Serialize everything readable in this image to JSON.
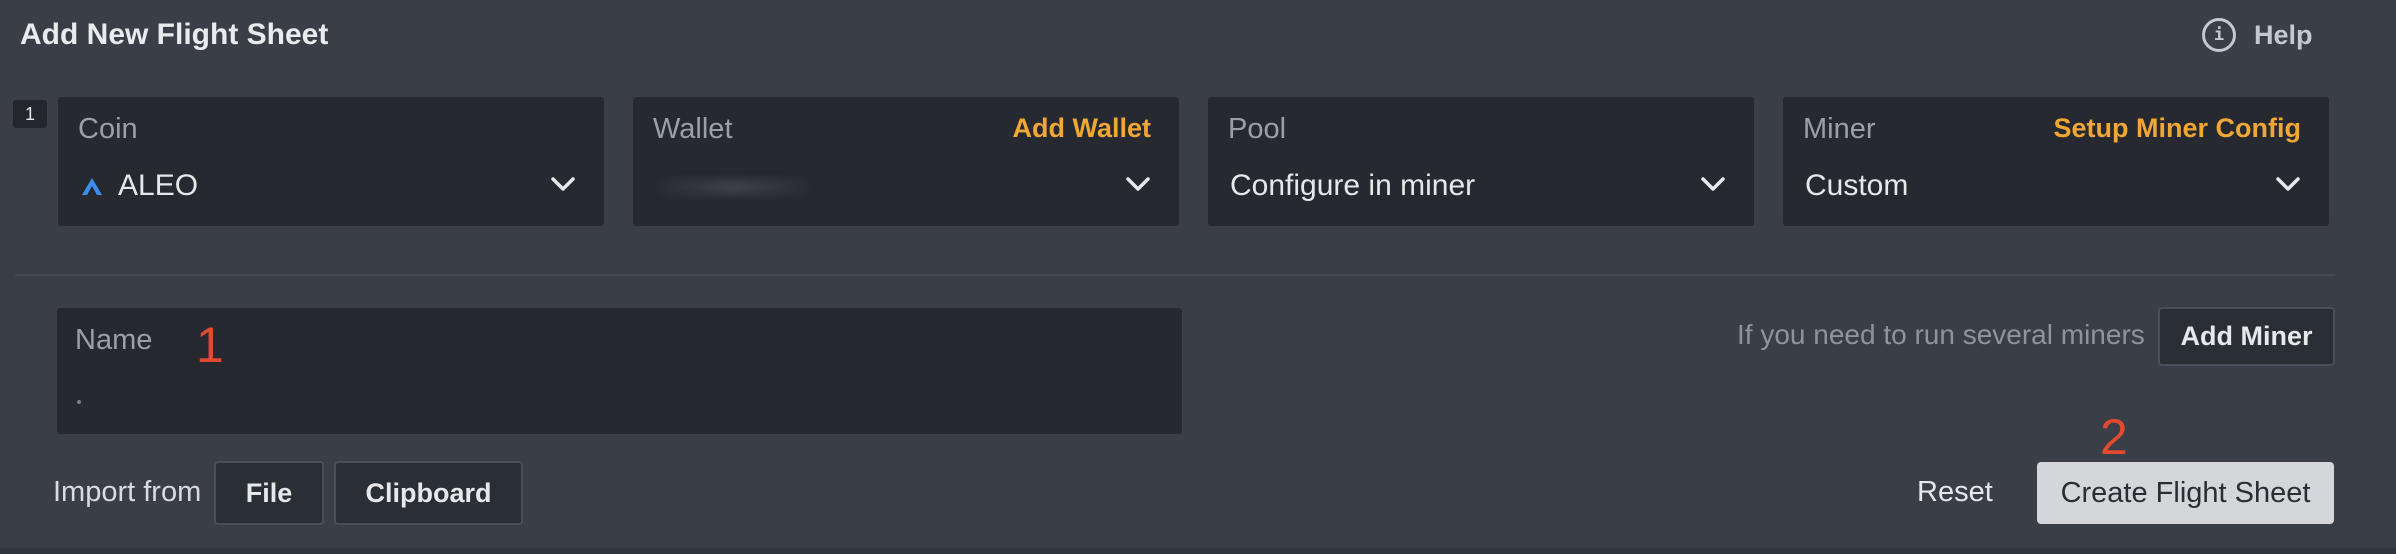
{
  "header": {
    "title": "Add New Flight Sheet",
    "help_label": "Help",
    "help_icon": "info-icon"
  },
  "row_number": "1",
  "cards": [
    {
      "label": "Coin",
      "action": "",
      "value": "ALEO",
      "icon": "aleo-logo-icon"
    },
    {
      "label": "Wallet",
      "action": "Add Wallet",
      "value": ""
    },
    {
      "label": "Pool",
      "action": "",
      "value": "Configure in miner"
    },
    {
      "label": "Miner",
      "action": "Setup Miner Config",
      "value": "Custom"
    }
  ],
  "name_field": {
    "label": "Name",
    "value": ""
  },
  "annotations": {
    "first": "1",
    "second": "2"
  },
  "miners": {
    "hint": "If you need to run several miners",
    "add_button": "Add Miner"
  },
  "import": {
    "label": "Import from",
    "file_button": "File",
    "clipboard_button": "Clipboard"
  },
  "footer": {
    "reset_label": "Reset",
    "create_label": "Create Flight Sheet"
  },
  "colors": {
    "accent": "#f0a733",
    "background": "#393e47",
    "card": "#262930",
    "annotation": "#e04a2e",
    "aleo_blue": "#3b8ff0"
  }
}
